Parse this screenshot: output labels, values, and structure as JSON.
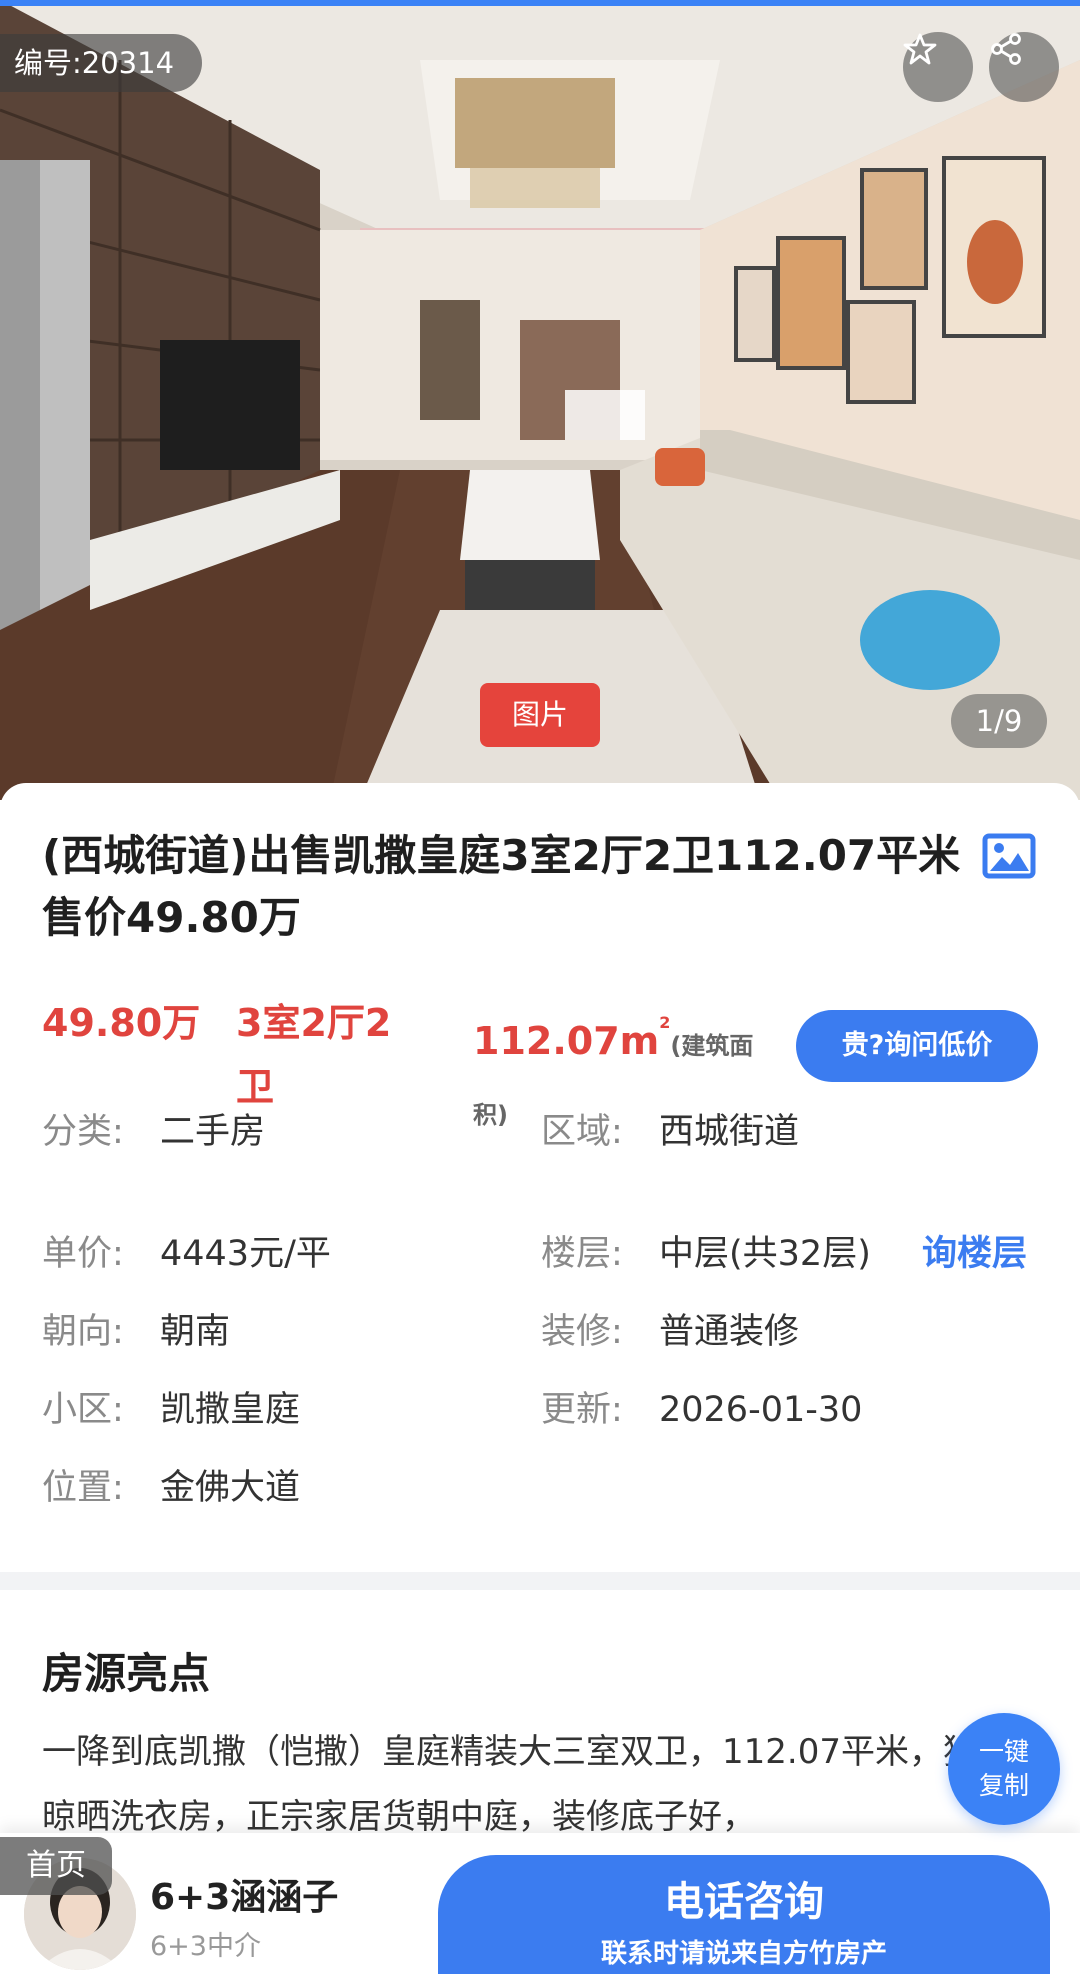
{
  "hero": {
    "listing_id": "编号:20314",
    "photo_tab": "图片",
    "pager": "1/9",
    "favorite_icon": "star-icon",
    "share_icon": "share-icon"
  },
  "listing": {
    "title": "(西城街道)出售凯撒皇庭3室2厅2卫112.07平米 售价49.80万",
    "title_icon": "image-icon",
    "price": "49.80万",
    "layout": "3室2厅2卫",
    "area": "112.07m",
    "area_sup": "2",
    "area_note": "(建筑面积)",
    "ask_price_button": "贵?询问低价"
  },
  "info": {
    "category_label": "分类:",
    "category_value": "二手房",
    "district_label": "区域:",
    "district_value": "西城街道",
    "unit_price_label": "单价:",
    "unit_price_value": "4443元/平",
    "floor_label": "楼层:",
    "floor_value": "中层(共32层)",
    "floor_link": "询楼层",
    "orientation_label": "朝向:",
    "orientation_value": "朝南",
    "decoration_label": "装修:",
    "decoration_value": "普通装修",
    "community_label": "小区:",
    "community_value": "凯撒皇庭",
    "updated_label": "更新:",
    "updated_value": "2026-01-30",
    "location_label": "位置:",
    "location_value": "金佛大道"
  },
  "highlights": {
    "title": "房源亮点",
    "text": "一降到底凯撒（恺撒）皇庭精装大三室双卫，112.07平米，独立晾晒洗衣房，正宗家居货朝中庭，装修底子好，",
    "copy_line1": "一键",
    "copy_line2": "复制"
  },
  "bottom_bar": {
    "home_tag": "首页",
    "agent_name": "6+3涵涵子",
    "agent_org": "6+3中介",
    "call_main": "电话咨询",
    "call_sub": "联系时请说来自方竹房产"
  },
  "colors": {
    "accent_blue": "#3b7cf0",
    "price_red": "#e0443e",
    "photo_tab_red": "#e5443c"
  }
}
